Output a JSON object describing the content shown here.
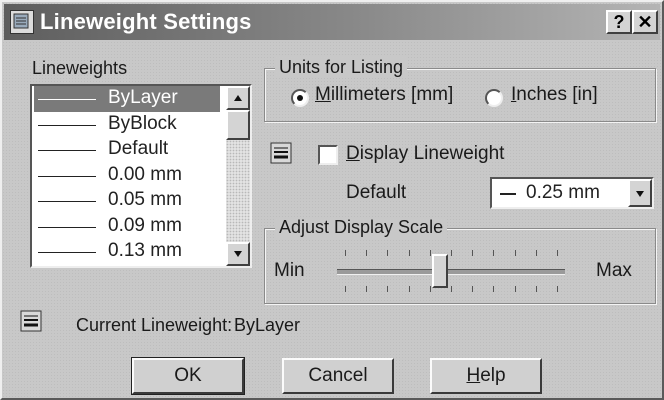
{
  "window": {
    "title": "Lineweight Settings",
    "help_glyph": "?",
    "close_glyph": "✕"
  },
  "lineweights": {
    "label": "Lineweights",
    "items": [
      {
        "label": "ByLayer",
        "selected": true
      },
      {
        "label": "ByBlock",
        "selected": false
      },
      {
        "label": "Default",
        "selected": false
      },
      {
        "label": "0.00 mm",
        "selected": false
      },
      {
        "label": "0.05 mm",
        "selected": false
      },
      {
        "label": "0.09 mm",
        "selected": false
      },
      {
        "label": "0.13 mm",
        "selected": false
      }
    ]
  },
  "units": {
    "label": "Units for Listing",
    "millimeters_label": "Millimeters [mm]",
    "inches_label": "Inches [in]",
    "selected": "millimeters"
  },
  "display": {
    "checkbox_label": "Display Lineweight",
    "checked": false
  },
  "default_lw": {
    "label": "Default",
    "value": "0.25 mm"
  },
  "scale": {
    "label": "Adjust Display Scale",
    "min_label": "Min",
    "max_label": "Max",
    "position_fraction": 0.45
  },
  "current": {
    "label": "Current Lineweight:",
    "value": "ByLayer"
  },
  "buttons": {
    "ok": "OK",
    "cancel": "Cancel",
    "help": "Help"
  }
}
